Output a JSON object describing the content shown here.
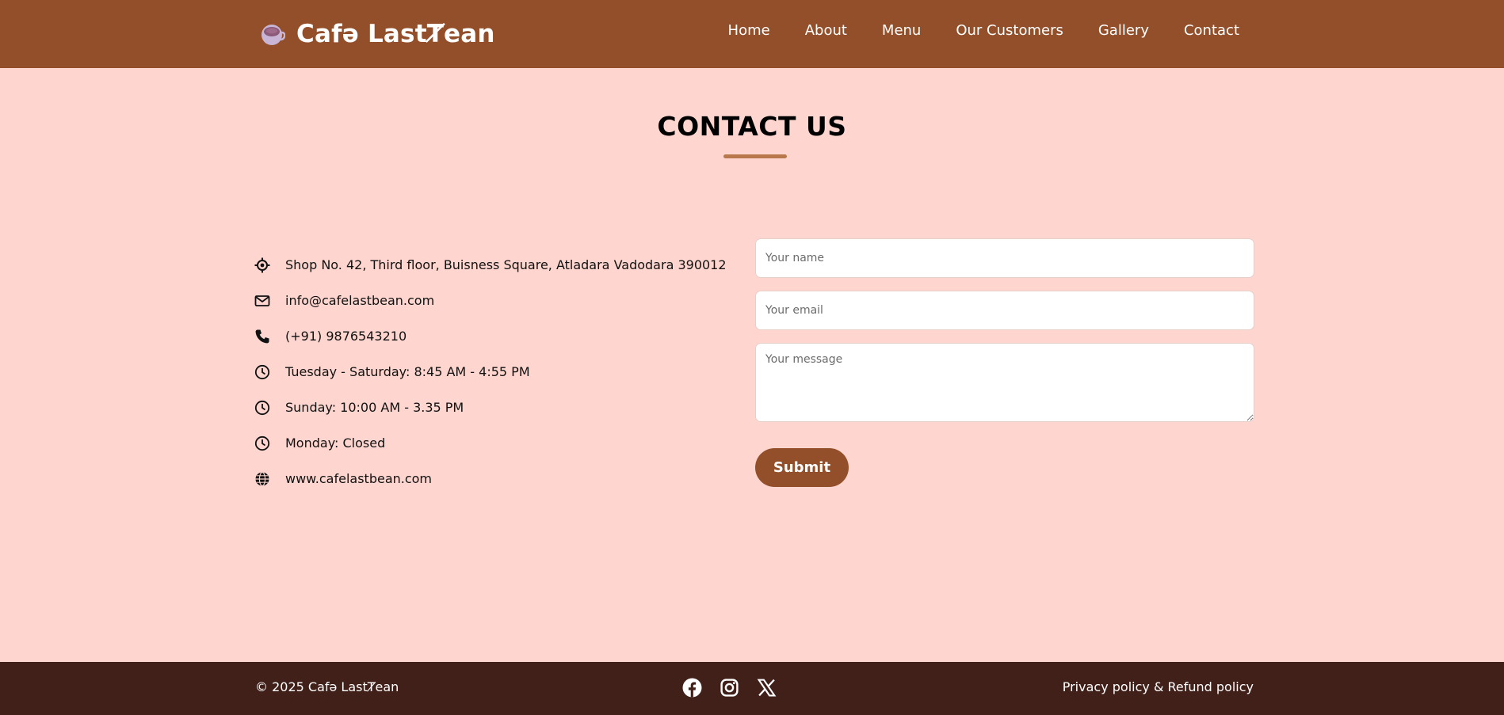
{
  "header": {
    "brand_name": "Cafə LastȾean",
    "nav": [
      {
        "label": "Home"
      },
      {
        "label": "About"
      },
      {
        "label": "Menu"
      },
      {
        "label": "Our Customers"
      },
      {
        "label": "Gallery"
      },
      {
        "label": "Contact"
      }
    ]
  },
  "main": {
    "title": "CONTACT US",
    "info": [
      {
        "icon": "location-icon",
        "text": "Shop No. 42, Third floor, Buisness Square, Atladara Vadodara 390012"
      },
      {
        "icon": "mail-icon",
        "text": "info@cafelastbean.com"
      },
      {
        "icon": "phone-icon",
        "text": "(+91) 9876543210"
      },
      {
        "icon": "clock-icon",
        "text": "Tuesday - Saturday: 8:45 AM - 4:55 PM"
      },
      {
        "icon": "clock-icon",
        "text": "Sunday: 10:00 AM - 3.35 PM"
      },
      {
        "icon": "clock-icon",
        "text": "Monday: Closed"
      },
      {
        "icon": "globe-icon",
        "text": "www.cafelastbean.com"
      }
    ],
    "form": {
      "name_placeholder": "Your name",
      "email_placeholder": "Your email",
      "message_placeholder": "Your message",
      "submit_label": "Submit"
    }
  },
  "footer": {
    "copyright": "© 2025 Cafə LastȾean",
    "socials": [
      "facebook-icon",
      "instagram-icon",
      "x-icon"
    ],
    "policy_label": "Privacy policy & Refund policy"
  },
  "colors": {
    "header_bg": "#934f29",
    "page_bg": "#fed6cf",
    "accent_underline": "#b9784c",
    "button_bg": "#934f29",
    "footer_bg": "#41201a"
  }
}
